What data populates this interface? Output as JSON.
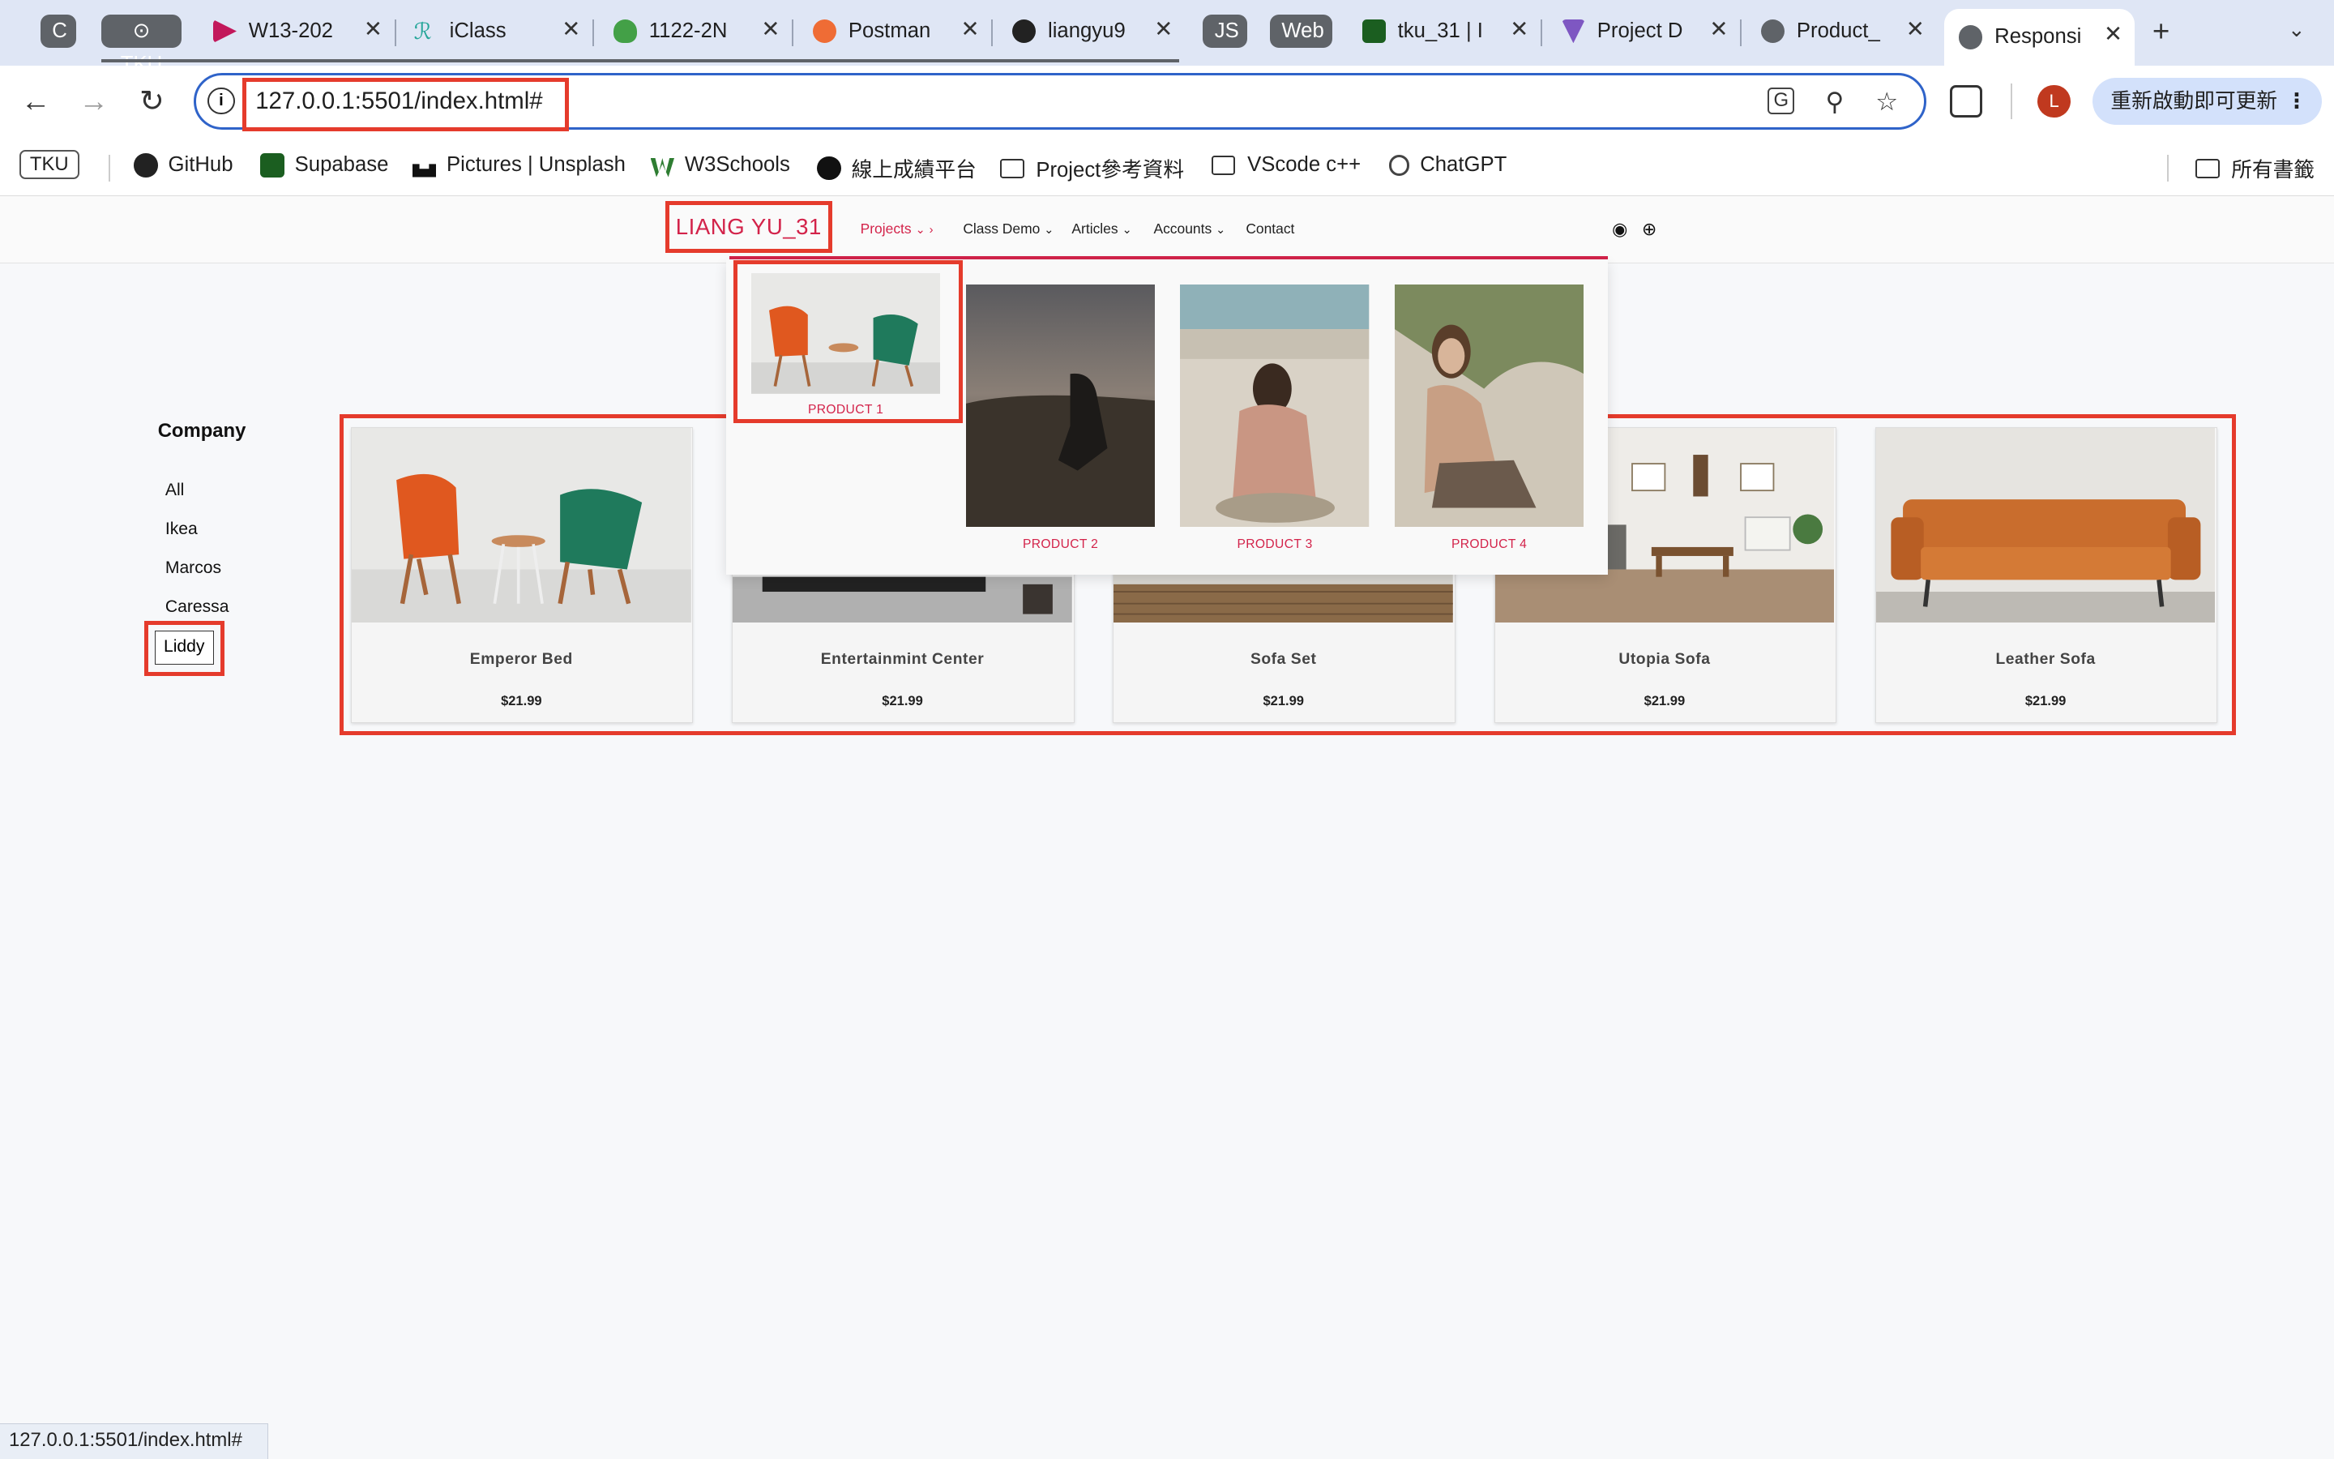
{
  "browser": {
    "tab_groups": [
      {
        "label": "C",
        "color": "#5f6368"
      },
      {
        "label": "TKU",
        "color": "#5f6368"
      },
      {
        "label": "JS",
        "color": "#5f6368"
      },
      {
        "label": "Web",
        "color": "#5f6368"
      }
    ],
    "tabs": [
      {
        "title": "W13-202",
        "favicon_color": "#c2185b"
      },
      {
        "title": "iClass",
        "favicon_color": "#26a69a"
      },
      {
        "title": "1122-2N",
        "favicon_color": "#43a047"
      },
      {
        "title": "Postman",
        "favicon_color": "#ef6c35"
      },
      {
        "title": "liangyu9",
        "favicon_color": "#222222"
      },
      {
        "title": "tku_31 | I",
        "favicon_color": "#1b5e20"
      },
      {
        "title": "Project D",
        "favicon_color": "#7e57c2"
      },
      {
        "title": "Product_",
        "favicon_color": "#5f6368"
      },
      {
        "title": "Responsi",
        "favicon_color": "#5f6368",
        "active": true
      }
    ],
    "new_tab": "+",
    "url": "127.0.0.1:5501/index.html#",
    "update_button": "重新啟動即可更新",
    "profile_initial": "L",
    "status_url": "127.0.0.1:5501/index.html#"
  },
  "bookmarks": {
    "tku": "TKU",
    "items": [
      "GitHub",
      "Supabase",
      "Pictures | Unsplash",
      "W3Schools",
      "線上成績平台",
      "Project參考資料",
      "VScode c++",
      "ChatGPT"
    ],
    "all_bookmarks": "所有書籤"
  },
  "site": {
    "brand": "LIANG YU_31",
    "nav": [
      "Projects",
      "Class Demo",
      "Articles",
      "Accounts",
      "Contact"
    ],
    "dropdown": [
      "PRODUCT 1",
      "PRODUCT 2",
      "PRODUCT 3",
      "PRODUCT 4"
    ],
    "sidebar_title": "Company",
    "companies": [
      "All",
      "Ikea",
      "Marcos",
      "Caressa",
      "Liddy"
    ],
    "products": [
      {
        "name": "Emperor Bed",
        "price": "$21.99"
      },
      {
        "name": "Entertainmint Center",
        "price": "$21.99"
      },
      {
        "name": "Sofa Set",
        "price": "$21.99"
      },
      {
        "name": "Utopia Sofa",
        "price": "$21.99"
      },
      {
        "name": "Leather Sofa",
        "price": "$21.99"
      }
    ]
  },
  "colors": {
    "accent": "#d3234a",
    "highlight": "#e53b2c",
    "omnibox_border": "#2f63c9"
  }
}
